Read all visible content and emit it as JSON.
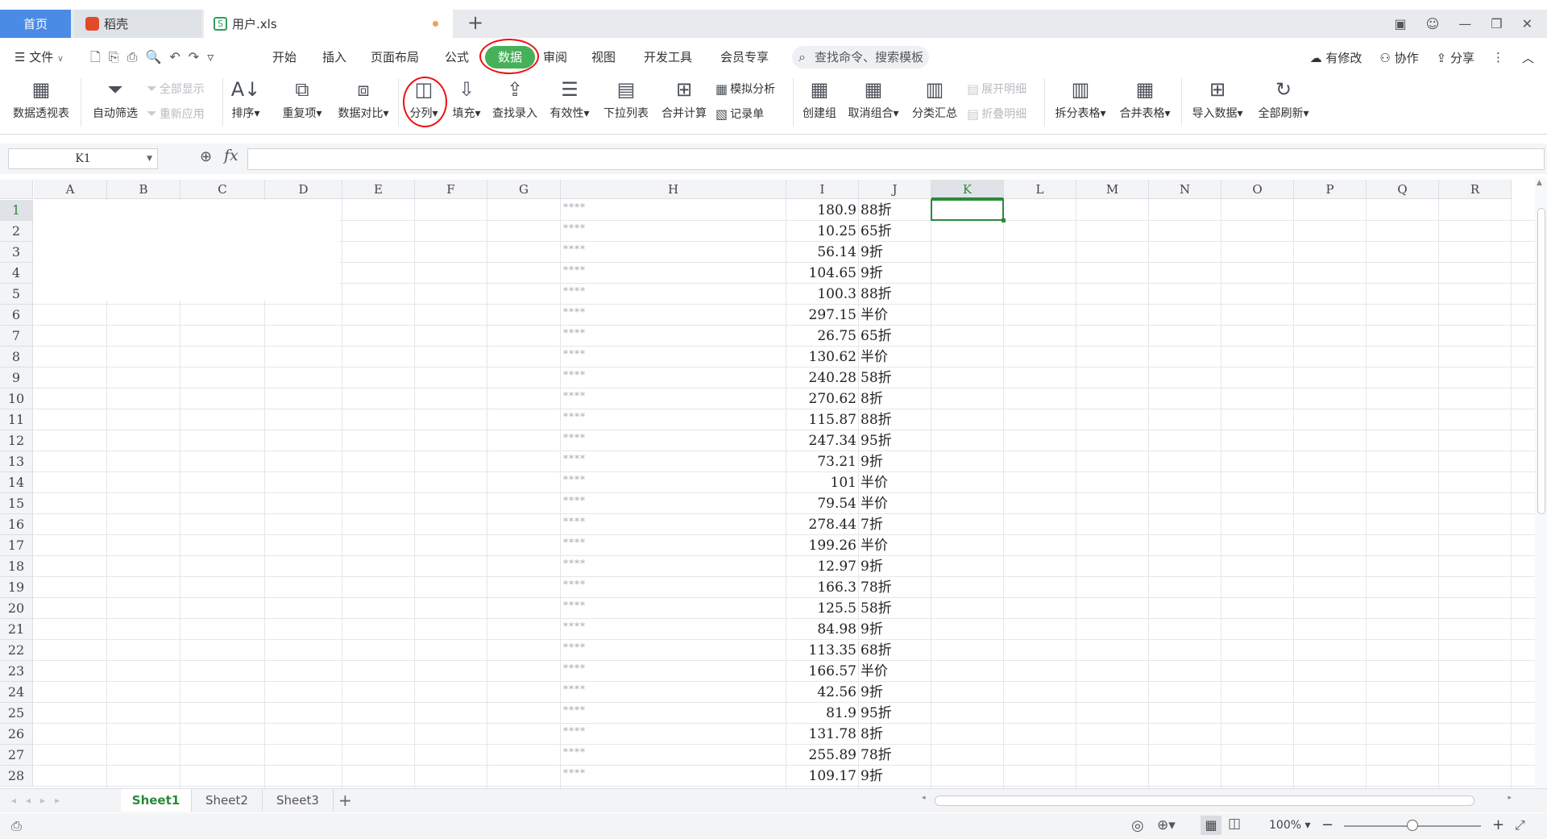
{
  "tabs": {
    "home": "首页",
    "daoke": "稻壳",
    "file": "用户.xls"
  },
  "menu": [
    "文件",
    "开始",
    "插入",
    "页面布局",
    "公式",
    "数据",
    "审阅",
    "视图",
    "开发工具",
    "会员专享"
  ],
  "search_placeholder": "查找命令、搜索模板",
  "right_menu": {
    "modified": "有修改",
    "collab": "协作",
    "share": "分享"
  },
  "ribbon": {
    "pivot": "数据透视表",
    "autofilter": "自动筛选",
    "show_all": "全部显示",
    "reapply": "重新应用",
    "sort": "排序",
    "duplicate": "重复项",
    "compare": "数据对比",
    "split": "分列",
    "fill": "填充",
    "lookup": "查找录入",
    "validity": "有效性",
    "dropdown": "下拉列表",
    "consolidate": "合并计算",
    "whatif": "模拟分析",
    "form": "记录单",
    "group": "创建组",
    "ungroup": "取消组合",
    "subtotal": "分类汇总",
    "expand": "展开明细",
    "collapse": "折叠明细",
    "split_table": "拆分表格",
    "merge_table": "合并表格",
    "import": "导入数据",
    "refresh_all": "全部刷新"
  },
  "name_box": "K1",
  "fx_label": "fx",
  "columns": [
    "A",
    "B",
    "C",
    "D",
    "E",
    "F",
    "G",
    "H",
    "I",
    "J",
    "K",
    "L",
    "M",
    "N",
    "O",
    "P",
    "Q",
    "R"
  ],
  "selected_column": "K",
  "masked_text": "****",
  "rows": [
    {
      "n": "1",
      "i": "180.9",
      "j": "88折"
    },
    {
      "n": "2",
      "i": "10.25",
      "j": "65折"
    },
    {
      "n": "3",
      "i": "56.14",
      "j": "9折"
    },
    {
      "n": "4",
      "i": "104.65",
      "j": "9折"
    },
    {
      "n": "5",
      "i": "100.3",
      "j": "88折"
    },
    {
      "n": "6",
      "i": "297.15",
      "j": "半价"
    },
    {
      "n": "7",
      "i": "26.75",
      "j": "65折"
    },
    {
      "n": "8",
      "i": "130.62",
      "j": "半价"
    },
    {
      "n": "9",
      "i": "240.28",
      "j": "58折"
    },
    {
      "n": "10",
      "i": "270.62",
      "j": "8折"
    },
    {
      "n": "11",
      "i": "115.87",
      "j": "88折"
    },
    {
      "n": "12",
      "i": "247.34",
      "j": "95折"
    },
    {
      "n": "13",
      "i": "73.21",
      "j": "9折"
    },
    {
      "n": "14",
      "i": "101",
      "j": "半价"
    },
    {
      "n": "15",
      "i": "79.54",
      "j": "半价"
    },
    {
      "n": "16",
      "i": "278.44",
      "j": "7折"
    },
    {
      "n": "17",
      "i": "199.26",
      "j": "半价"
    },
    {
      "n": "18",
      "i": "12.97",
      "j": "9折"
    },
    {
      "n": "19",
      "i": "166.3",
      "j": "78折"
    },
    {
      "n": "20",
      "i": "125.5",
      "j": "58折"
    },
    {
      "n": "21",
      "i": "84.98",
      "j": "9折"
    },
    {
      "n": "22",
      "i": "113.35",
      "j": "68折"
    },
    {
      "n": "23",
      "i": "166.57",
      "j": "半价"
    },
    {
      "n": "24",
      "i": "42.56",
      "j": "9折"
    },
    {
      "n": "25",
      "i": "81.9",
      "j": "95折"
    },
    {
      "n": "26",
      "i": "131.78",
      "j": "8折"
    },
    {
      "n": "27",
      "i": "255.89",
      "j": "78折"
    },
    {
      "n": "28",
      "i": "109.17",
      "j": "9折"
    }
  ],
  "sheets": [
    "Sheet1",
    "Sheet2",
    "Sheet3"
  ],
  "active_sheet": "Sheet1",
  "zoom": "100%",
  "colors": {
    "accent_green": "#47b05a",
    "home_tab_blue": "#4a8be6",
    "annotation_red": "#e11111"
  }
}
